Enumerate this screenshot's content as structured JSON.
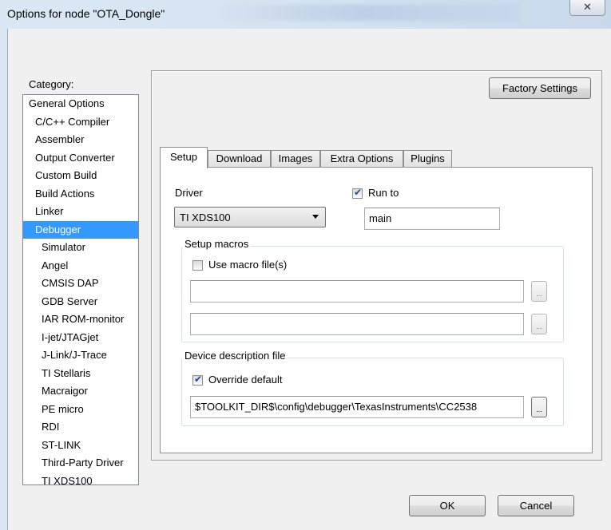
{
  "window": {
    "title": "Options for node \"OTA_Dongle\"",
    "close_glyph": "✕"
  },
  "category": {
    "label": "Category:",
    "items": [
      {
        "label": "General Options"
      },
      {
        "label": "C/C++ Compiler"
      },
      {
        "label": "Assembler"
      },
      {
        "label": "Output Converter"
      },
      {
        "label": "Custom Build"
      },
      {
        "label": "Build Actions"
      },
      {
        "label": "Linker"
      },
      {
        "label": "Debugger"
      },
      {
        "label": "Simulator"
      },
      {
        "label": "Angel"
      },
      {
        "label": "CMSIS DAP"
      },
      {
        "label": "GDB Server"
      },
      {
        "label": "IAR ROM-monitor"
      },
      {
        "label": "I-jet/JTAGjet"
      },
      {
        "label": "J-Link/J-Trace"
      },
      {
        "label": "TI Stellaris"
      },
      {
        "label": "Macraigor"
      },
      {
        "label": "PE micro"
      },
      {
        "label": "RDI"
      },
      {
        "label": "ST-LINK"
      },
      {
        "label": "Third-Party Driver"
      },
      {
        "label": "TI XDS100"
      }
    ],
    "selected": "Debugger"
  },
  "factory_settings_label": "Factory Settings",
  "tabs": [
    "Setup",
    "Download",
    "Images",
    "Extra Options",
    "Plugins"
  ],
  "active_tab": "Setup",
  "setup": {
    "driver_label": "Driver",
    "driver_value": "TI XDS100",
    "run_to_label": "Run to",
    "run_to_checked": true,
    "run_to_value": "main",
    "setup_macros_title": "Setup macros",
    "use_macro_label": "Use macro file(s)",
    "use_macro_checked": false,
    "macro_file_1": "",
    "macro_file_2": "",
    "browse_label": "...",
    "device_desc_title": "Device description file",
    "override_label": "Override default",
    "override_checked": true,
    "device_desc_path": "$TOOLKIT_DIR$\\config\\debugger\\TexasInstruments\\CC2538"
  },
  "buttons": {
    "ok": "OK",
    "cancel": "Cancel"
  }
}
